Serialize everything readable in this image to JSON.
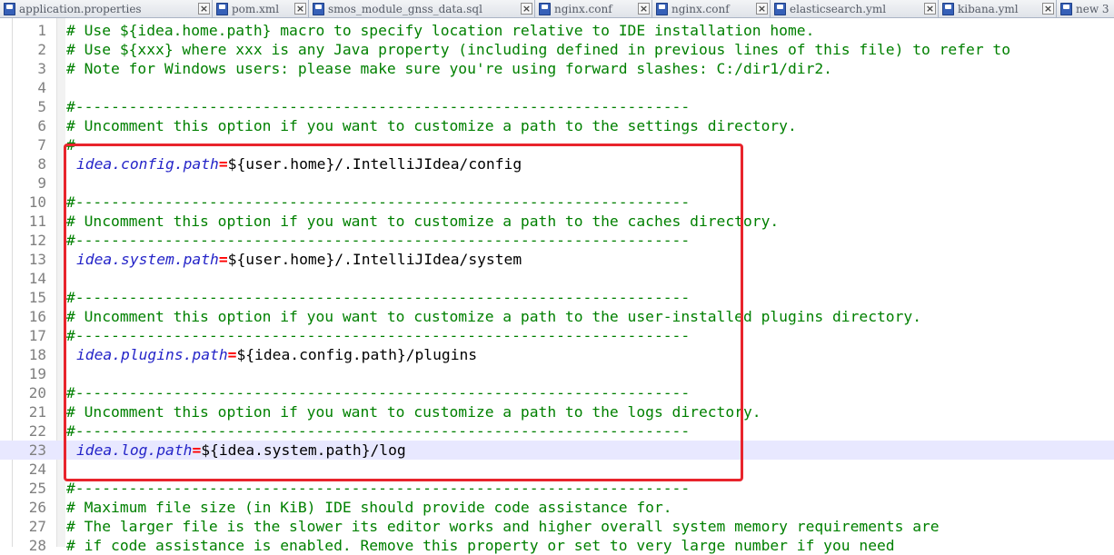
{
  "tabs": [
    {
      "label": "application.properties",
      "icon": "file-icon"
    },
    {
      "label": "pom.xml",
      "icon": "file-icon"
    },
    {
      "label": "smos_module_gnss_data.sql",
      "icon": "file-icon"
    },
    {
      "label": "nginx.conf",
      "icon": "file-icon"
    },
    {
      "label": "nginx.conf",
      "icon": "file-icon"
    },
    {
      "label": "elasticsearch.yml",
      "icon": "file-icon"
    },
    {
      "label": "kibana.yml",
      "icon": "file-icon"
    },
    {
      "label": "new 3",
      "icon": "file-icon"
    }
  ],
  "editor": {
    "current_line": 23,
    "lines": [
      {
        "n": "1",
        "comment": "# Use ${idea.home.path} macro to specify location relative to IDE installation home."
      },
      {
        "n": "2",
        "comment": "# Use ${xxx} where xxx is any Java property (including defined in previous lines of this file) to refer to"
      },
      {
        "n": "3",
        "comment": "# Note for Windows users: please make sure you're using forward slashes: C:/dir1/dir2."
      },
      {
        "n": "4",
        "comment": ""
      },
      {
        "n": "5",
        "comment": "#---------------------------------------------------------------------"
      },
      {
        "n": "6",
        "comment": "# Uncomment this option if you want to customize a path to the settings directory."
      },
      {
        "n": "7",
        "comment": "#---------------------------------------------------------------------"
      },
      {
        "n": "8",
        "key": "idea.config.path",
        "eq": "=",
        "value": "${user.home}/.IntelliJIdea/config"
      },
      {
        "n": "9",
        "comment": ""
      },
      {
        "n": "10",
        "comment": "#---------------------------------------------------------------------"
      },
      {
        "n": "11",
        "comment": "# Uncomment this option if you want to customize a path to the caches directory."
      },
      {
        "n": "12",
        "comment": "#---------------------------------------------------------------------"
      },
      {
        "n": "13",
        "key": "idea.system.path",
        "eq": "=",
        "value": "${user.home}/.IntelliJIdea/system"
      },
      {
        "n": "14",
        "comment": ""
      },
      {
        "n": "15",
        "comment": "#---------------------------------------------------------------------"
      },
      {
        "n": "16",
        "comment": "# Uncomment this option if you want to customize a path to the user-installed plugins directory."
      },
      {
        "n": "17",
        "comment": "#---------------------------------------------------------------------"
      },
      {
        "n": "18",
        "key": "idea.plugins.path",
        "eq": "=",
        "value": "${idea.config.path}/plugins"
      },
      {
        "n": "19",
        "comment": ""
      },
      {
        "n": "20",
        "comment": "#---------------------------------------------------------------------"
      },
      {
        "n": "21",
        "comment": "# Uncomment this option if you want to customize a path to the logs directory."
      },
      {
        "n": "22",
        "comment": "#---------------------------------------------------------------------"
      },
      {
        "n": "23",
        "key": "idea.log.path",
        "eq": "=",
        "value": "${idea.system.path}/log"
      },
      {
        "n": "24",
        "comment": ""
      },
      {
        "n": "25",
        "comment": "#---------------------------------------------------------------------"
      },
      {
        "n": "26",
        "comment": "# Maximum file size (in KiB) IDE should provide code assistance for."
      },
      {
        "n": "27",
        "comment": "# The larger file is the slower its editor works and higher overall system memory requirements are"
      },
      {
        "n": "28",
        "comment": "# if code assistance is enabled. Remove this property or set to very large number if you need"
      }
    ]
  },
  "colors": {
    "comment": "#008000",
    "key": "#2424c8",
    "equals": "#ff0000",
    "highlight_box": "#e8242c",
    "current_line_bg": "#e8e8ff"
  }
}
